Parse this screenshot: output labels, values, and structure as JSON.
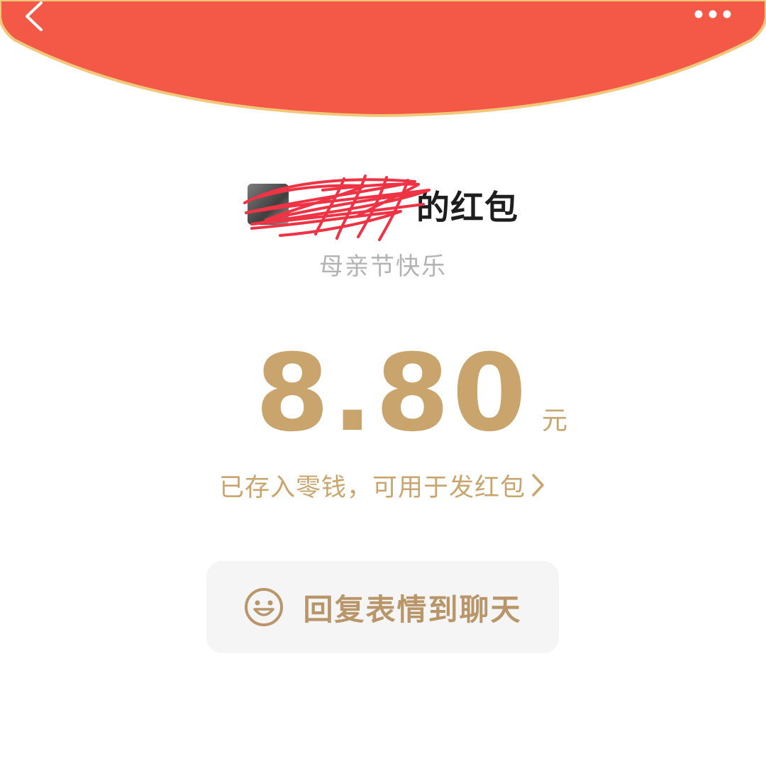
{
  "header": {
    "back_icon": "chevron-left-icon",
    "more_icon": "more-dots-icon",
    "background_color": "#f45846",
    "border_color": "#f3c77a"
  },
  "sender": {
    "name_suffix": "的红包",
    "redacted": true
  },
  "greeting": {
    "text": "母亲节快乐"
  },
  "amount": {
    "value": "8.80",
    "unit": "元",
    "color": "#c9a56d"
  },
  "status": {
    "text": "已存入零钱，可用于发红包",
    "chevron_icon": "chevron-right-icon"
  },
  "reply": {
    "label": "回复表情到聊天",
    "icon": "smile-icon"
  }
}
